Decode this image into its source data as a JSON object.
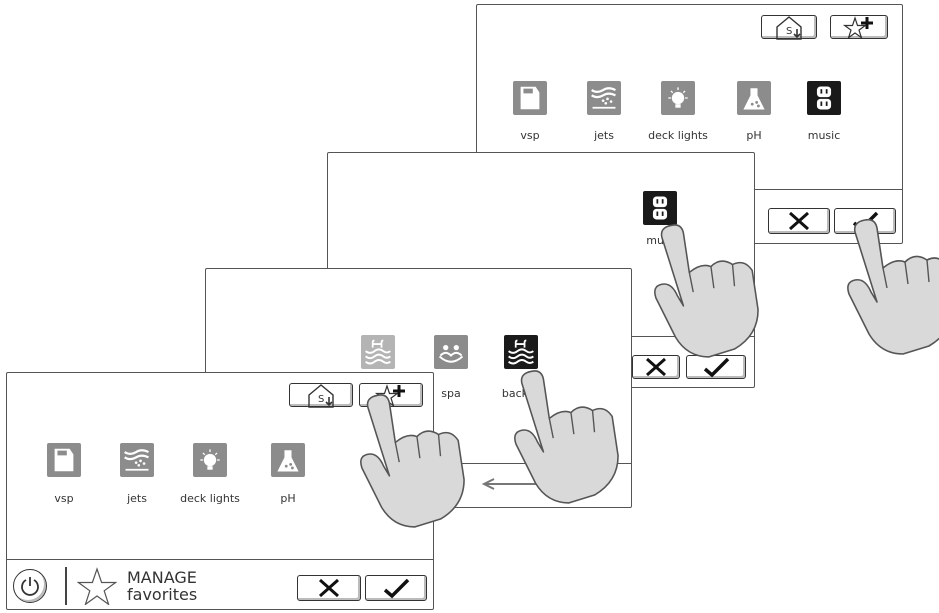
{
  "labels": {
    "vsp": "vsp",
    "jets": "jets",
    "deck_lights": "deck lights",
    "ph": "pH",
    "music": "music",
    "music_partial": "mus",
    "spa": "spa",
    "backyard_partial": "backy"
  },
  "bottom_bar": {
    "line1": "MANAGE",
    "line2": "favorites"
  },
  "icons": {
    "vsp": "pump-icon",
    "jets": "jets-icon",
    "deck_lights": "light-bulb-icon",
    "ph": "flask-icon",
    "music": "power-outlet-icon",
    "spa": "spa-icon",
    "backyard": "pool-icon",
    "home_s": "home-schedule-icon",
    "fav_add": "star-plus-icon",
    "cancel": "x-icon",
    "confirm": "check-icon",
    "power": "power-icon",
    "star": "star-outline-icon"
  },
  "colors": {
    "tile_gray": "#8c8c8c",
    "tile_black": "#1a1a1a",
    "hand_fill": "#d9d9d9",
    "outline": "#555555"
  }
}
